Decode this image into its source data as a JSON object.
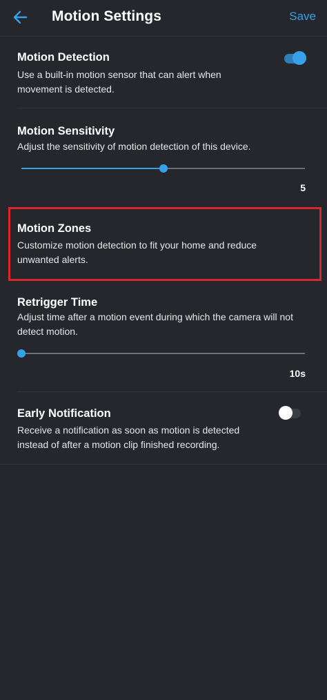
{
  "header": {
    "title": "Motion Settings",
    "save_label": "Save",
    "back_icon": "arrow-left-icon"
  },
  "colors": {
    "background": "#25272c",
    "accent": "#35a1e8",
    "highlight": "#d9262f",
    "divider": "#34363b"
  },
  "motion_detection": {
    "title": "Motion Detection",
    "description": "Use a built-in motion sensor that can alert when movement is detected.",
    "enabled": true
  },
  "motion_sensitivity": {
    "title": "Motion Sensitivity",
    "description": "Adjust the sensitivity of motion detection of this device.",
    "value": 5,
    "value_label": "5",
    "level_fraction": 0.5
  },
  "motion_zones": {
    "title": "Motion Zones",
    "description": "Customize motion detection to fit your home and reduce unwanted alerts."
  },
  "retrigger_time": {
    "title": "Retrigger Time",
    "description": "Adjust time after a motion event during which the camera will not detect motion.",
    "value_label": "10s",
    "level_fraction": 0
  },
  "early_notification": {
    "title": "Early Notification",
    "description": "Receive a notification as soon as motion is detected instead of after a motion clip finished recording.",
    "enabled": false
  }
}
